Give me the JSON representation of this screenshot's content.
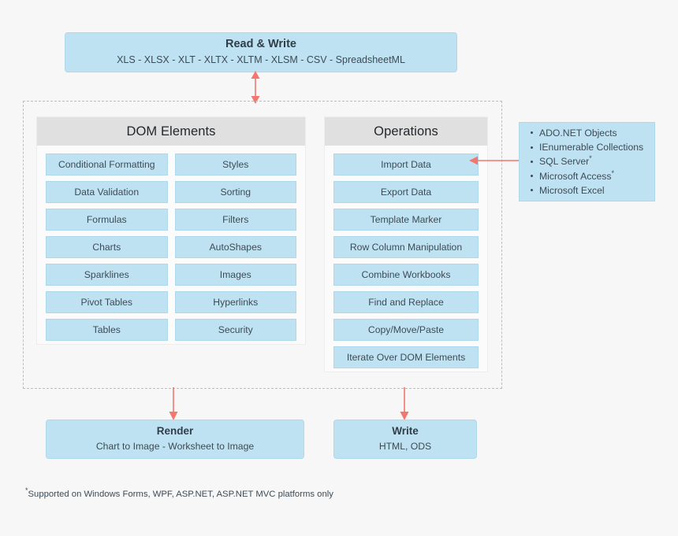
{
  "colors": {
    "background": "#f7f7f7",
    "box_fill": "#bfe2f2",
    "box_border": "#aed8ec",
    "panel_header": "#e0e0e0",
    "panel_fill": "#fbfbfb",
    "dashed_border": "#bdbdbd",
    "arrow": "#f4776f",
    "text": "#3d4b56"
  },
  "read_write": {
    "title": "Read & Write",
    "formats": "XLS - XLSX - XLT - XLTX - XLTM - XLSM - CSV -  SpreadsheetML"
  },
  "dom_elements": {
    "header": "DOM Elements",
    "left_column": [
      "Conditional Formatting",
      "Data Validation",
      "Formulas",
      "Charts",
      "Sparklines",
      "Pivot Tables",
      "Tables"
    ],
    "right_column": [
      "Styles",
      "Sorting",
      "Filters",
      "AutoShapes",
      "Images",
      "Hyperlinks",
      "Security"
    ]
  },
  "operations": {
    "header": "Operations",
    "items": [
      "Import Data",
      "Export Data",
      "Template Marker",
      "Row Column Manipulation",
      "Combine Workbooks",
      "Find and Replace",
      "Copy/Move/Paste",
      "Iterate Over DOM Elements"
    ]
  },
  "data_sources": {
    "items": [
      {
        "label": "ADO.NET Objects",
        "footnote_marker": ""
      },
      {
        "label": "IEnumerable Collections",
        "footnote_marker": ""
      },
      {
        "label": "SQL Server",
        "footnote_marker": "*"
      },
      {
        "label": "Microsoft Access",
        "footnote_marker": "*"
      },
      {
        "label": "Microsoft Excel",
        "footnote_marker": ""
      }
    ]
  },
  "render": {
    "title": "Render",
    "subtitle": "Chart to Image - Worksheet to Image"
  },
  "write": {
    "title": "Write",
    "subtitle": "HTML, ODS"
  },
  "footnote": {
    "marker": "*",
    "text": "Supported on Windows Forms, WPF, ASP.NET, ASP.NET MVC platforms only"
  }
}
